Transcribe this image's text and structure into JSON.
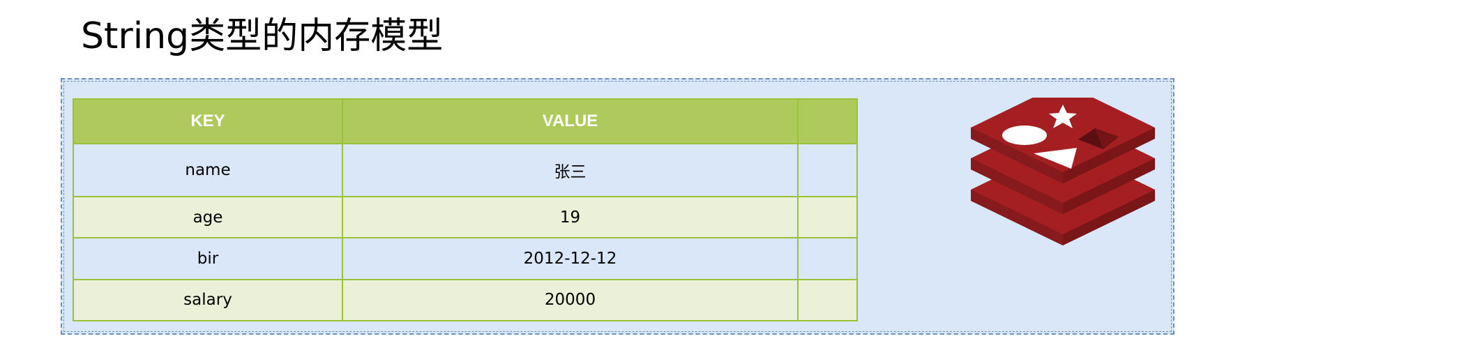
{
  "title": "String类型的内存模型",
  "table": {
    "headers": [
      "KEY",
      "VALUE",
      ""
    ],
    "rows": [
      {
        "key": "name",
        "value": "张三",
        "extra": ""
      },
      {
        "key": "age",
        "value": "19",
        "extra": ""
      },
      {
        "key": "bir",
        "value": "2012-12-12",
        "extra": ""
      },
      {
        "key": "salary",
        "value": "20000",
        "extra": ""
      }
    ]
  },
  "logo": {
    "icon": "redis-logo-icon"
  },
  "colors": {
    "frame_fill": "#dae7f8",
    "frame_border": "#6c8ebf",
    "header_fill": "#aec95c",
    "table_border": "#9ac238",
    "row_blue": "#dae7f8",
    "row_green": "#ebf1d8",
    "logo_red": "#a41e22"
  }
}
